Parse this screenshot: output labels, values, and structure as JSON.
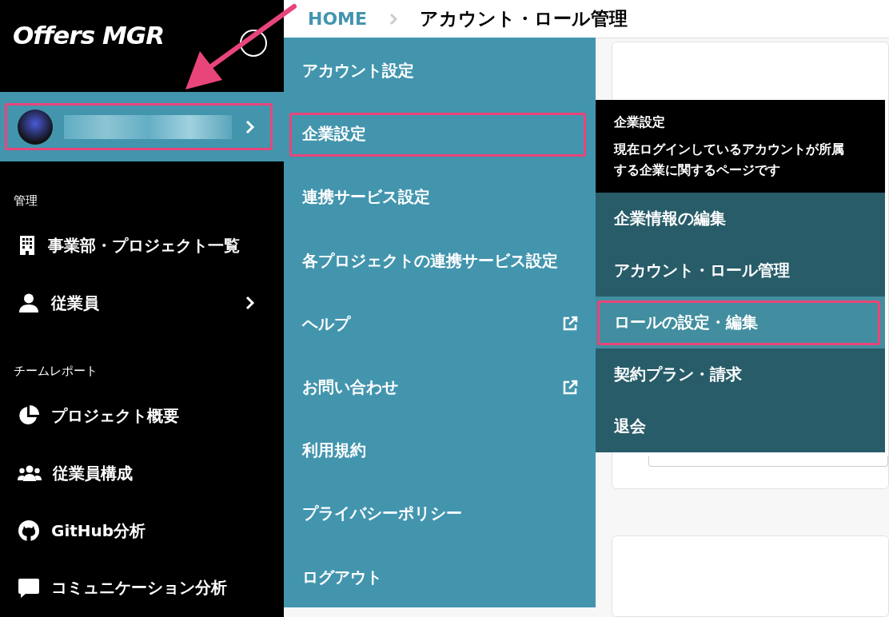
{
  "logo": "Offers MGR",
  "user": {
    "highlighted": true
  },
  "sidebar": {
    "sections": [
      {
        "label": "管理",
        "items": [
          {
            "label": "事業部・プロジェクト一覧",
            "has_submenu": false
          },
          {
            "label": "従業員",
            "has_submenu": true
          }
        ]
      },
      {
        "label": "チームレポート",
        "items": [
          {
            "label": "プロジェクト概要",
            "has_submenu": false
          },
          {
            "label": "従業員構成",
            "has_submenu": false
          },
          {
            "label": "GitHub分析",
            "has_submenu": false
          },
          {
            "label": "コミュニケーション分析",
            "has_submenu": false
          }
        ]
      }
    ]
  },
  "breadcrumb": {
    "home": "HOME",
    "current": "アカウント・ロール管理"
  },
  "menu": {
    "items": [
      {
        "label": "アカウント設定",
        "external": false,
        "highlighted": false
      },
      {
        "label": "企業設定",
        "external": false,
        "highlighted": true
      },
      {
        "label": "連携サービス設定",
        "external": false,
        "highlighted": false
      },
      {
        "label": "各プロジェクトの連携サービス設定",
        "external": false,
        "highlighted": false
      },
      {
        "label": "ヘルプ",
        "external": true,
        "highlighted": false
      },
      {
        "label": "お問い合わせ",
        "external": true,
        "highlighted": false
      },
      {
        "label": "利用規約",
        "external": false,
        "highlighted": false
      },
      {
        "label": "プライバシーポリシー",
        "external": false,
        "highlighted": false
      },
      {
        "label": "ログアウト",
        "external": false,
        "highlighted": false
      }
    ]
  },
  "submenu": {
    "title": "企業設定",
    "description": "現在ログインしているアカウントが所属する企業に関するページです",
    "items": [
      {
        "label": "企業情報の編集",
        "selected": false,
        "highlighted": false
      },
      {
        "label": "アカウント・ロール管理",
        "selected": false,
        "highlighted": false
      },
      {
        "label": "ロールの設定・編集",
        "selected": true,
        "highlighted": true
      },
      {
        "label": "契約プラン・請求",
        "selected": false,
        "highlighted": false
      },
      {
        "label": "退会",
        "selected": false,
        "highlighted": false
      }
    ]
  }
}
